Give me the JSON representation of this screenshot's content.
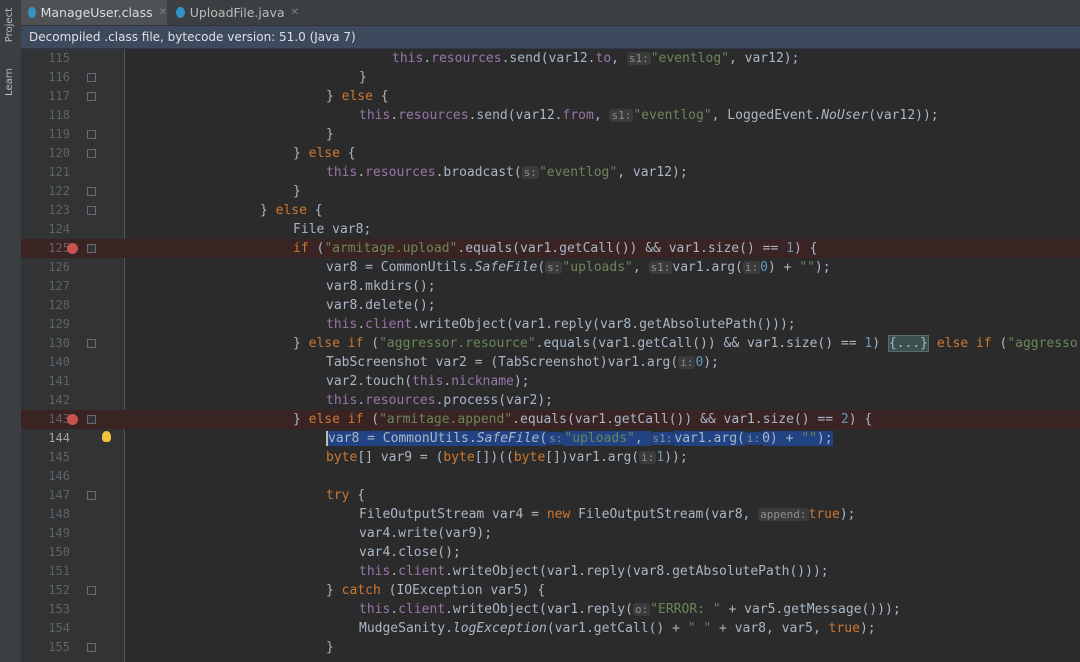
{
  "sidebar": {
    "tabs": [
      {
        "label": "Project",
        "icon": "folder-icon"
      },
      {
        "label": "Learn",
        "icon": "learn-icon"
      }
    ]
  },
  "tabs": [
    {
      "label": "ManageUser.class",
      "active": true,
      "icon_color": "#3592c4"
    },
    {
      "label": "UploadFile.java",
      "active": false,
      "icon_color": "#3592c4"
    }
  ],
  "banner": {
    "text": "Decompiled .class file, bytecode version: 51.0 (Java 7)"
  },
  "editor": {
    "current_line": "144",
    "breakpoint_lines": [
      "125",
      "143"
    ],
    "lines": [
      {
        "n": "115",
        "i": 8,
        "t": [
          [
            "fld",
            "this"
          ],
          [
            "p",
            "."
          ],
          [
            "fld",
            "resources"
          ],
          [
            "p",
            ".send(var12."
          ],
          [
            "fld",
            "to"
          ],
          [
            "p",
            ", "
          ],
          [
            "h",
            "s1:"
          ],
          [
            "str",
            "\"eventlog\""
          ],
          [
            "p",
            ", var12);"
          ]
        ]
      },
      {
        "n": "116",
        "i": 7,
        "t": [
          [
            "p",
            "}"
          ]
        ]
      },
      {
        "n": "117",
        "i": 6,
        "t": [
          [
            "p",
            "} "
          ],
          [
            "kw",
            "else"
          ],
          [
            "p",
            " {"
          ]
        ]
      },
      {
        "n": "118",
        "i": 7,
        "t": [
          [
            "fld",
            "this"
          ],
          [
            "p",
            "."
          ],
          [
            "fld",
            "resources"
          ],
          [
            "p",
            ".send(var12."
          ],
          [
            "fld",
            "from"
          ],
          [
            "p",
            ", "
          ],
          [
            "h",
            "s1:"
          ],
          [
            "str",
            "\"eventlog\""
          ],
          [
            "p",
            ", LoggedEvent."
          ],
          [
            "it",
            "NoUser"
          ],
          [
            "p",
            "(var12));"
          ]
        ]
      },
      {
        "n": "119",
        "i": 6,
        "t": [
          [
            "p",
            "}"
          ]
        ]
      },
      {
        "n": "120",
        "i": 5,
        "t": [
          [
            "p",
            "} "
          ],
          [
            "kw",
            "else"
          ],
          [
            "p",
            " {"
          ]
        ]
      },
      {
        "n": "121",
        "i": 6,
        "t": [
          [
            "fld",
            "this"
          ],
          [
            "p",
            "."
          ],
          [
            "fld",
            "resources"
          ],
          [
            "p",
            ".broadcast("
          ],
          [
            "h",
            "s:"
          ],
          [
            "str",
            "\"eventlog\""
          ],
          [
            "p",
            ", var12);"
          ]
        ]
      },
      {
        "n": "122",
        "i": 5,
        "t": [
          [
            "p",
            "}"
          ]
        ]
      },
      {
        "n": "123",
        "i": 4,
        "t": [
          [
            "p",
            "} "
          ],
          [
            "kw",
            "else"
          ],
          [
            "p",
            " {"
          ]
        ]
      },
      {
        "n": "124",
        "i": 5,
        "t": [
          [
            "p",
            "File var8;"
          ]
        ]
      },
      {
        "n": "125",
        "i": 5,
        "t": [
          [
            "kw",
            "if"
          ],
          [
            "p",
            " ("
          ],
          [
            "str",
            "\"armitage.upload\""
          ],
          [
            "p",
            ".equals(var1.getCall()) && var1.size() == "
          ],
          [
            "num",
            "1"
          ],
          [
            "p",
            ") {"
          ]
        ]
      },
      {
        "n": "126",
        "i": 6,
        "t": [
          [
            "p",
            "var8 = CommonUtils."
          ],
          [
            "it",
            "SafeFile"
          ],
          [
            "p",
            "("
          ],
          [
            "h",
            "s:"
          ],
          [
            "str",
            "\"uploads\""
          ],
          [
            "p",
            ", "
          ],
          [
            "h",
            "s1:"
          ],
          [
            "p",
            "var1.arg("
          ],
          [
            "h",
            "i:"
          ],
          [
            "num",
            "0"
          ],
          [
            "p",
            ") + "
          ],
          [
            "str",
            "\"\""
          ],
          [
            "p",
            ");"
          ]
        ]
      },
      {
        "n": "127",
        "i": 6,
        "t": [
          [
            "p",
            "var8.mkdirs();"
          ]
        ]
      },
      {
        "n": "128",
        "i": 6,
        "t": [
          [
            "p",
            "var8.delete();"
          ]
        ]
      },
      {
        "n": "129",
        "i": 6,
        "t": [
          [
            "fld",
            "this"
          ],
          [
            "p",
            "."
          ],
          [
            "fld",
            "client"
          ],
          [
            "p",
            ".writeObject(var1.reply(var8.getAbsolutePath()));"
          ]
        ]
      },
      {
        "n": "130",
        "i": 5,
        "t": [
          [
            "p",
            "} "
          ],
          [
            "kw",
            "else if"
          ],
          [
            "p",
            " ("
          ],
          [
            "str",
            "\"aggressor.resource\""
          ],
          [
            "p",
            ".equals(var1.getCall()) && var1.size() == "
          ],
          [
            "num",
            "1"
          ],
          [
            "p",
            ") "
          ],
          [
            "fb",
            "{...}"
          ],
          [
            "p",
            " "
          ],
          [
            "kw",
            "else if"
          ],
          [
            "p",
            " ("
          ],
          [
            "str",
            "\"aggressor.sysinfo\""
          ]
        ]
      },
      {
        "n": "140",
        "i": 6,
        "t": [
          [
            "p",
            "TabScreenshot var2 = (TabScreenshot)var1.arg("
          ],
          [
            "h",
            "i:"
          ],
          [
            "num",
            "0"
          ],
          [
            "p",
            ");"
          ]
        ]
      },
      {
        "n": "141",
        "i": 6,
        "t": [
          [
            "p",
            "var2.touch("
          ],
          [
            "fld",
            "this"
          ],
          [
            "p",
            "."
          ],
          [
            "fld",
            "nickname"
          ],
          [
            "p",
            ");"
          ]
        ]
      },
      {
        "n": "142",
        "i": 6,
        "t": [
          [
            "fld",
            "this"
          ],
          [
            "p",
            "."
          ],
          [
            "fld",
            "resources"
          ],
          [
            "p",
            ".process(var2);"
          ]
        ]
      },
      {
        "n": "143",
        "i": 5,
        "t": [
          [
            "p",
            "} "
          ],
          [
            "kw",
            "else if"
          ],
          [
            "p",
            " ("
          ],
          [
            "str",
            "\"armitage.append\""
          ],
          [
            "p",
            ".equals(var1.getCall()) && var1.size() == "
          ],
          [
            "num",
            "2"
          ],
          [
            "p",
            ") {"
          ]
        ]
      },
      {
        "n": "144",
        "i": 6,
        "t": [
          [
            "sel",
            "var8 = CommonUtils."
          ],
          [
            "selit",
            "SafeFile"
          ],
          [
            "sel",
            "("
          ],
          [
            "selh",
            "s:"
          ],
          [
            "selstr",
            "\"uploads\""
          ],
          [
            "sel",
            ", "
          ],
          [
            "selh",
            "s1:"
          ],
          [
            "sel",
            "var1.arg("
          ],
          [
            "selh",
            "i:"
          ],
          [
            "sel",
            "0) + "
          ],
          [
            "selstr",
            "\"\""
          ],
          [
            "sel",
            ");"
          ]
        ]
      },
      {
        "n": "145",
        "i": 6,
        "t": [
          [
            "kw",
            "byte"
          ],
          [
            "p",
            "[] var9 = ("
          ],
          [
            "kw",
            "byte"
          ],
          [
            "p",
            "[])(("
          ],
          [
            "kw",
            "byte"
          ],
          [
            "p",
            "[])var1.arg("
          ],
          [
            "h",
            "i:"
          ],
          [
            "num",
            "1"
          ],
          [
            "p",
            "));"
          ]
        ]
      },
      {
        "n": "146",
        "i": 0,
        "t": []
      },
      {
        "n": "147",
        "i": 6,
        "t": [
          [
            "kw",
            "try"
          ],
          [
            "p",
            " {"
          ]
        ]
      },
      {
        "n": "148",
        "i": 7,
        "t": [
          [
            "p",
            "FileOutputStream var4 = "
          ],
          [
            "kw",
            "new"
          ],
          [
            "p",
            " FileOutputStream(var8, "
          ],
          [
            "h",
            "append:"
          ],
          [
            "kw",
            "true"
          ],
          [
            "p",
            ");"
          ]
        ]
      },
      {
        "n": "149",
        "i": 7,
        "t": [
          [
            "p",
            "var4.write(var9);"
          ]
        ]
      },
      {
        "n": "150",
        "i": 7,
        "t": [
          [
            "p",
            "var4.close();"
          ]
        ]
      },
      {
        "n": "151",
        "i": 7,
        "t": [
          [
            "fld",
            "this"
          ],
          [
            "p",
            "."
          ],
          [
            "fld",
            "client"
          ],
          [
            "p",
            ".writeObject(var1.reply(var8.getAbsolutePath()));"
          ]
        ]
      },
      {
        "n": "152",
        "i": 6,
        "t": [
          [
            "p",
            "} "
          ],
          [
            "kw",
            "catch"
          ],
          [
            "p",
            " (IOException var5) {"
          ]
        ]
      },
      {
        "n": "153",
        "i": 7,
        "t": [
          [
            "fld",
            "this"
          ],
          [
            "p",
            "."
          ],
          [
            "fld",
            "client"
          ],
          [
            "p",
            ".writeObject(var1.reply("
          ],
          [
            "h",
            "o:"
          ],
          [
            "str",
            "\"ERROR: \""
          ],
          [
            "p",
            " + var5.getMessage()));"
          ]
        ]
      },
      {
        "n": "154",
        "i": 7,
        "t": [
          [
            "p",
            "MudgeSanity."
          ],
          [
            "it",
            "logException"
          ],
          [
            "p",
            "(var1.getCall() + "
          ],
          [
            "str",
            "\" \""
          ],
          [
            "p",
            " + var8, var5, "
          ],
          [
            "kw",
            "true"
          ],
          [
            "p",
            ");"
          ]
        ]
      },
      {
        "n": "155",
        "i": 6,
        "t": [
          [
            "p",
            "}"
          ]
        ]
      }
    ]
  },
  "colors": {
    "keyword": "#cc7832",
    "string": "#6a8759",
    "field": "#9876aa",
    "text": "#a9b7c6",
    "selection": "#214283",
    "breakpoint": "#c75450"
  }
}
